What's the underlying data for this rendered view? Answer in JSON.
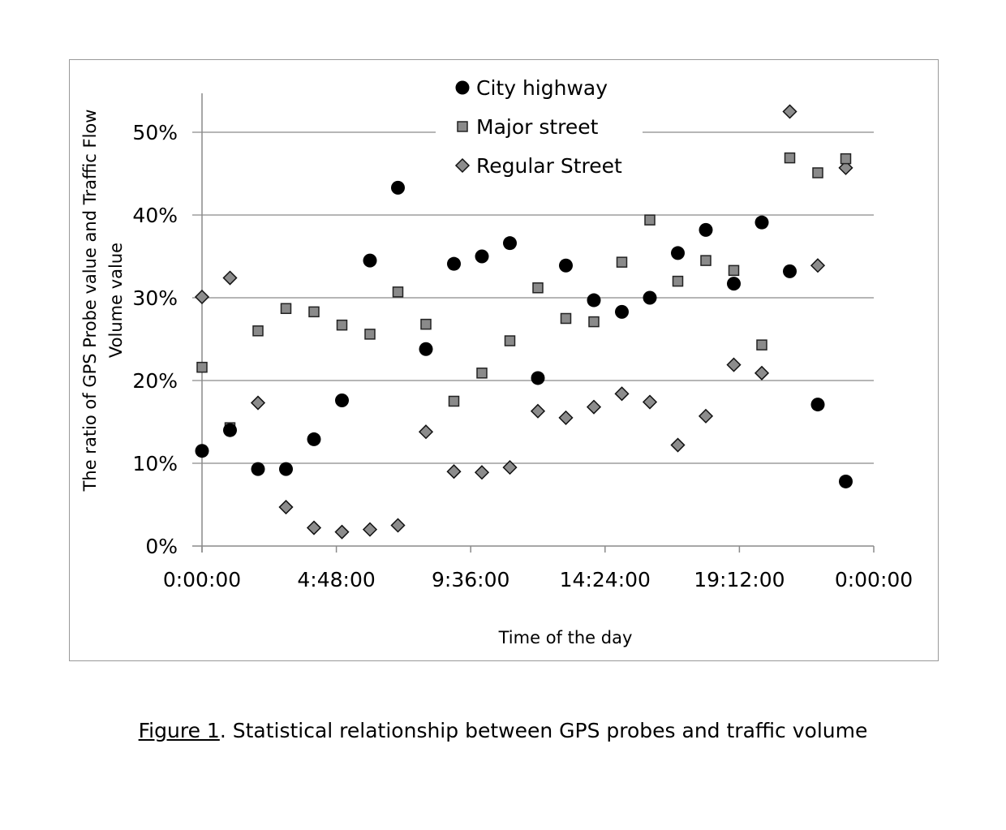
{
  "chart_data": {
    "type": "scatter",
    "title": "",
    "xlabel": "Time of the day",
    "ylabel": "The ratio of GPS Probe value and Traffic Flow Volume value",
    "ylabel_lines": [
      "The ratio of GPS Probe value and Traffic Flow",
      "Volume value"
    ],
    "x_unit": "hours",
    "xlim": [
      0,
      24
    ],
    "ylim": [
      0,
      55
    ],
    "x_ticks": [
      0,
      4.8,
      9.6,
      14.4,
      19.2,
      24
    ],
    "x_tick_labels": [
      "0:00:00",
      "4:48:00",
      "9:36:00",
      "14:24:00",
      "19:12:00",
      "0:00:00"
    ],
    "y_ticks": [
      0,
      10,
      20,
      30,
      40,
      50
    ],
    "y_tick_labels": [
      "0%",
      "10%",
      "20%",
      "30%",
      "40%",
      "50%"
    ],
    "grid": "horizontal",
    "legend_position": "top-center",
    "x": [
      0,
      1,
      2,
      3,
      4,
      5,
      6,
      7,
      8,
      9,
      10,
      11,
      12,
      13,
      14,
      15,
      16,
      17,
      18,
      19,
      20,
      21,
      22,
      23
    ],
    "series": [
      {
        "name": "City highway",
        "marker": "circle",
        "color": "#000000",
        "values": [
          11.5,
          14.0,
          9.3,
          9.3,
          12.9,
          17.6,
          34.5,
          43.3,
          23.8,
          34.1,
          35.0,
          36.6,
          20.3,
          33.9,
          29.7,
          28.3,
          30.0,
          35.4,
          38.2,
          31.7,
          39.1,
          33.2,
          17.1,
          7.8
        ]
      },
      {
        "name": "Major street",
        "marker": "square",
        "color": "#8a8a8a",
        "values": [
          21.6,
          14.3,
          26.0,
          28.7,
          28.3,
          26.7,
          25.6,
          30.7,
          26.8,
          17.5,
          20.9,
          24.8,
          31.2,
          27.5,
          27.1,
          34.3,
          39.4,
          32.0,
          34.5,
          33.3,
          24.3,
          46.9,
          45.1,
          46.8
        ]
      },
      {
        "name": "Regular Street",
        "marker": "diamond",
        "color": "#8c8c8c",
        "values": [
          30.1,
          32.4,
          17.3,
          4.7,
          2.2,
          1.7,
          2.0,
          2.5,
          13.8,
          9.0,
          8.9,
          9.5,
          16.3,
          15.5,
          16.8,
          18.4,
          17.4,
          12.2,
          15.7,
          21.9,
          20.9,
          52.5,
          33.9,
          45.7
        ]
      }
    ]
  },
  "caption": {
    "figure_label": "Figure 1",
    "text": ". Statistical relationship between GPS probes and traffic volume"
  }
}
